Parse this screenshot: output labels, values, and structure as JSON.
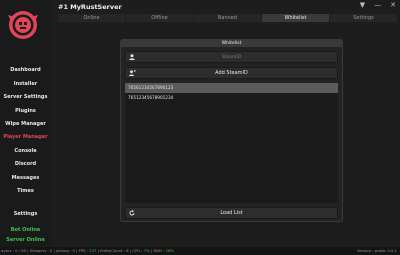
{
  "window_controls": {
    "menu": "▼",
    "minimize": "—",
    "close": "✕"
  },
  "app": {
    "title": "#1 MyRustServer"
  },
  "sidebar": {
    "items": [
      {
        "label": "Dashboard"
      },
      {
        "label": "Installer"
      },
      {
        "label": "Server Settings"
      },
      {
        "label": "Plugins"
      },
      {
        "label": "Wipe Manager"
      },
      {
        "label": "Player Manager"
      },
      {
        "label": "Console"
      },
      {
        "label": "Discord"
      },
      {
        "label": "Messages"
      },
      {
        "label": "Times"
      }
    ],
    "settings_label": "Settings",
    "bot_status": "Bot Online",
    "server_status": "Server Online"
  },
  "tabs": [
    {
      "label": "Online"
    },
    {
      "label": "Offline"
    },
    {
      "label": "Banned"
    },
    {
      "label": "Whitelist"
    },
    {
      "label": "Settings"
    }
  ],
  "panel": {
    "title": "Whitelist",
    "steamid_placeholder": "SteamID",
    "add_label": "Add SteamID",
    "entries": [
      "76561234567890123",
      "76512345678901234"
    ],
    "load_label": "Load List"
  },
  "footer": {
    "left_prefix": "ayers : 0 / 50 | Sleepers : 0 | Joining : 0 | FPS :",
    "fps": "237",
    "entity_part": "| EntityCount : 6 | CPU :",
    "cpu": "7%",
    "ram_part": "| RAM :",
    "ram": "26%",
    "version": "Version : public 0.0.1"
  },
  "colors": {
    "accent": "#e0455a",
    "online": "#3ec34a"
  }
}
